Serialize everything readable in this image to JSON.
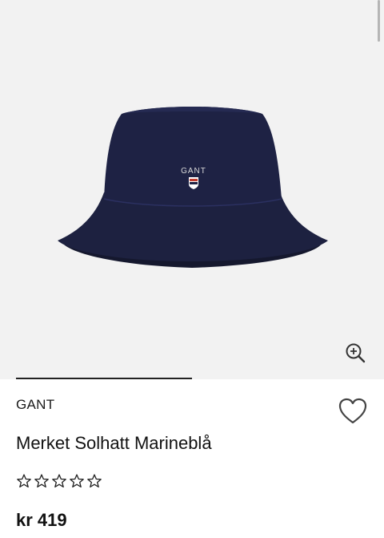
{
  "product": {
    "brand": "GANT",
    "name": "Merket Solhatt Marineblå",
    "price": "kr 419",
    "rating": 0,
    "rating_max": 5,
    "image_logo_text": "GANT",
    "color_accent": "#1b1f3b"
  },
  "gallery": {
    "zoom_icon": "zoom-in-icon",
    "wishlist_icon": "heart-icon"
  }
}
